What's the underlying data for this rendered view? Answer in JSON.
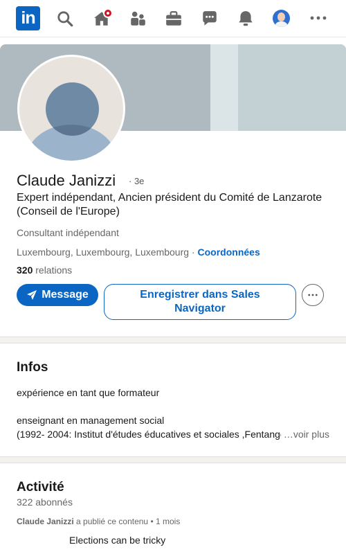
{
  "nav": {
    "logo_text": "in",
    "icons": [
      "search-icon",
      "home-icon",
      "my-network-icon",
      "jobs-icon",
      "messaging-icon",
      "notifications-icon",
      "profile-avatar",
      "more-icon"
    ],
    "brand_color": "#0a66c2",
    "badge_color": "#d11124"
  },
  "profile": {
    "name": "Claude Janizzi",
    "degree": "· 3e",
    "headline": "Expert indépendant, Ancien président du Comité de Lanzarote (Conseil de l'Europe)",
    "job": "Consultant indépendant",
    "location": "Luxembourg, Luxembourg, Luxembourg",
    "location_sep": " · ",
    "contact_link": "Coordonnées",
    "connections_count": "320",
    "connections_label": " relations"
  },
  "actions": {
    "message_label": "Message",
    "sales_label": "Enregistrer dans Sales Navigator"
  },
  "about": {
    "title": "Infos",
    "line1": "expérience en tant que formateur",
    "line2": "enseignant en management social",
    "line3": "(1992- 2004: Institut d'études éducatives et sociales ,Fentange",
    "see_more": "…voir plus"
  },
  "activity": {
    "title": "Activité",
    "followers": "322 abonnés",
    "post_author": "Claude Janizzi",
    "post_action": " a publié ce contenu",
    "post_time": " • 1 mois",
    "post_text": "Elections can be tricky"
  }
}
